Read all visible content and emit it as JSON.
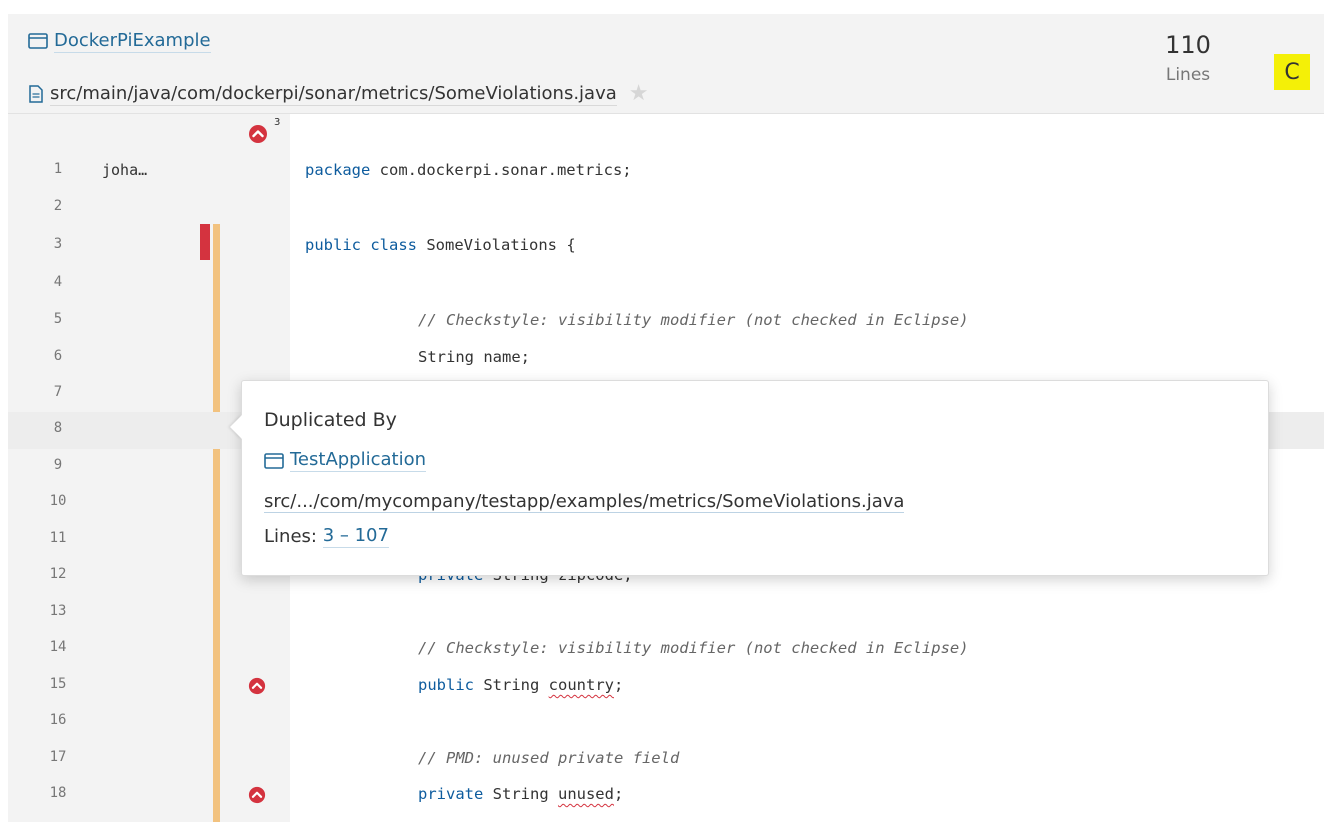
{
  "header": {
    "project_name": "DockerPiExample",
    "file_path": "src/main/java/com/dockerpi/sonar/metrics/SomeViolations.java",
    "lines_value": "110",
    "lines_label": "Lines",
    "rating": "C",
    "rating_color": "#f4f007"
  },
  "gutter": {
    "issue_count_top": "3"
  },
  "source": {
    "lines": [
      {
        "n": "1",
        "author": "joha…"
      },
      {
        "n": "2"
      },
      {
        "n": "3"
      },
      {
        "n": "4"
      },
      {
        "n": "5"
      },
      {
        "n": "6"
      },
      {
        "n": "7"
      },
      {
        "n": "8"
      },
      {
        "n": "9"
      },
      {
        "n": "10"
      },
      {
        "n": "11"
      },
      {
        "n": "12"
      },
      {
        "n": "13"
      },
      {
        "n": "14"
      },
      {
        "n": "15"
      },
      {
        "n": "16"
      },
      {
        "n": "17"
      },
      {
        "n": "18"
      }
    ],
    "code": {
      "l1_kw": "package",
      "l1_rest": " com.dockerpi.sonar.metrics;",
      "l3_kw1": "public",
      "l3_kw2": "class",
      "l3_rest": " SomeViolations {",
      "l5_comment": "// Checkstyle: visibility modifier (not checked in Eclipse)",
      "l6_text": "String name;",
      "l12_kw": "private",
      "l12_rest": " String zipcode;",
      "l14_comment": "// Checkstyle: visibility modifier (not checked in Eclipse)",
      "l15_kw": "public",
      "l15_mid": " String ",
      "l15_ident": "country",
      "l15_end": ";",
      "l17_comment": "// PMD: unused private field",
      "l18_kw": "private",
      "l18_mid": " String ",
      "l18_ident": "unused",
      "l18_end": ";"
    }
  },
  "popup": {
    "title": "Duplicated By",
    "project": "TestApplication",
    "path": "src/.../com/mycompany/testapp/examples/metrics/SomeViolations.java",
    "lines_label": "Lines: ",
    "lines_range": "3 – 107"
  },
  "colors": {
    "link": "#236a97",
    "keyword": "#0e5c9e",
    "duplication": "#f2c27f",
    "scm_change": "#d4333f",
    "issue": "#d4333f"
  }
}
